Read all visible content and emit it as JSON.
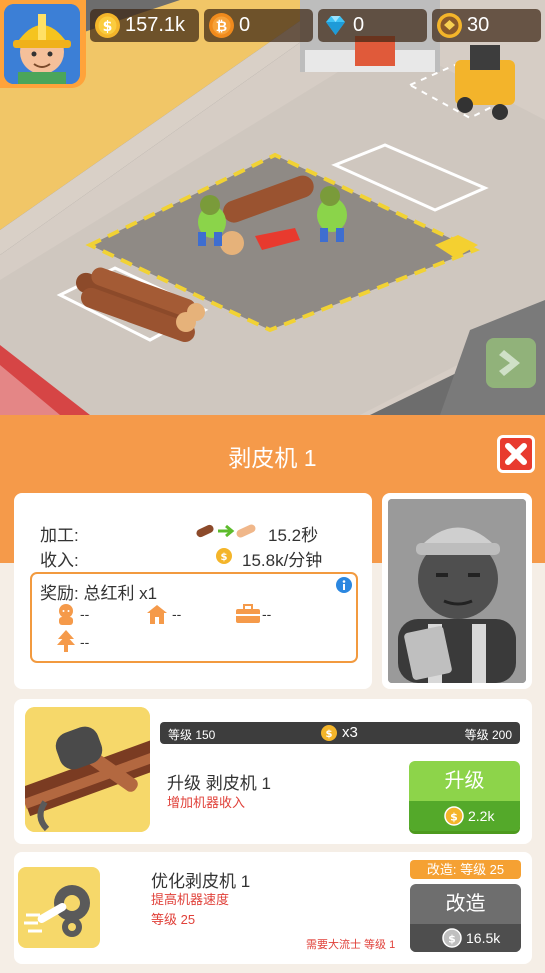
{
  "hud": {
    "coins": "157.1k",
    "bitcoin": "0",
    "gems": "0",
    "tokens": "30",
    "icons": [
      "avatar-worker-icon",
      "coin-icon",
      "bitcoin-icon",
      "diamond-icon",
      "token-icon"
    ]
  },
  "panel": {
    "title": "剥皮机 1",
    "process_label": "加工:",
    "process_time": "15.2秒",
    "income_label": "收入:",
    "income_value": "15.8k/分钟",
    "bonus_label": "奖励: 总红利 x1",
    "bonus_values": [
      "--",
      "--",
      "--",
      "--"
    ],
    "upgrade": {
      "level_from": "等级 150",
      "multiplier": "x3",
      "level_to": "等级 200",
      "progress": 0.0,
      "title": "升级 剥皮机 1",
      "subtitle": "增加机器收入",
      "button": "升级",
      "cost": "2.2k"
    },
    "optimize": {
      "title": "优化剥皮机 1",
      "subtitle": "提高机器速度",
      "level": "等级 25",
      "tag": "改造: 等级 25",
      "button": "改造",
      "cost": "16.5k",
      "requirement": "需要大流士 等级 1"
    }
  },
  "colors": {
    "accent_orange": "#f59a4a",
    "close_red": "#e83a2e",
    "button_green": "#8dd44a",
    "requirement_red": "#e0413a"
  }
}
